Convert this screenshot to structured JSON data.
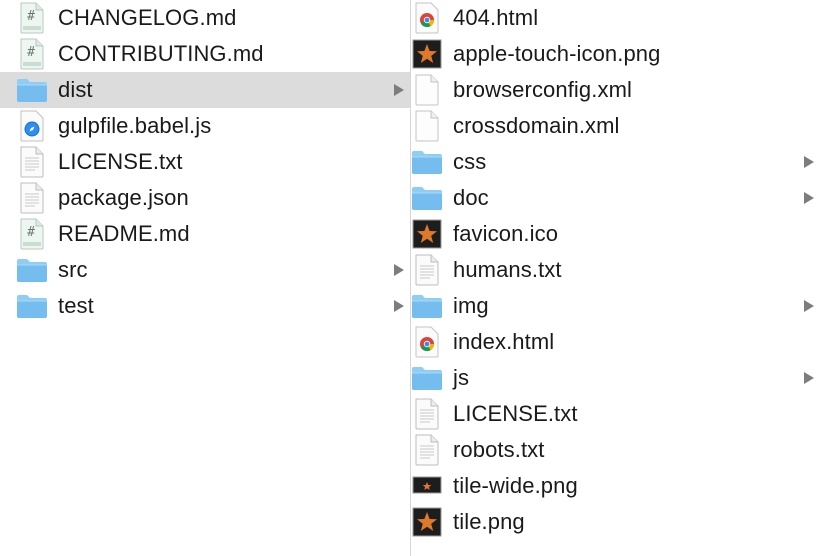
{
  "left_column": [
    {
      "name": "CHANGELOG.md",
      "icon": "markdown-file-icon",
      "folder": false
    },
    {
      "name": "CONTRIBUTING.md",
      "icon": "markdown-file-icon",
      "folder": false
    },
    {
      "name": "dist",
      "icon": "folder-icon",
      "folder": true,
      "selected": true
    },
    {
      "name": "gulpfile.babel.js",
      "icon": "safari-file-icon",
      "folder": false
    },
    {
      "name": "LICENSE.txt",
      "icon": "text-file-icon",
      "folder": false
    },
    {
      "name": "package.json",
      "icon": "text-file-icon",
      "folder": false
    },
    {
      "name": "README.md",
      "icon": "markdown-file-icon",
      "folder": false
    },
    {
      "name": "src",
      "icon": "folder-icon",
      "folder": true
    },
    {
      "name": "test",
      "icon": "folder-icon",
      "folder": true
    }
  ],
  "right_column": [
    {
      "name": "404.html",
      "icon": "chrome-file-icon",
      "folder": false
    },
    {
      "name": "apple-touch-icon.png",
      "icon": "star-image-icon",
      "folder": false
    },
    {
      "name": "browserconfig.xml",
      "icon": "blank-file-icon",
      "folder": false
    },
    {
      "name": "crossdomain.xml",
      "icon": "blank-file-icon",
      "folder": false
    },
    {
      "name": "css",
      "icon": "folder-icon",
      "folder": true
    },
    {
      "name": "doc",
      "icon": "folder-icon",
      "folder": true
    },
    {
      "name": "favicon.ico",
      "icon": "star-image-icon",
      "folder": false
    },
    {
      "name": "humans.txt",
      "icon": "text-file-icon",
      "folder": false
    },
    {
      "name": "img",
      "icon": "folder-icon",
      "folder": true
    },
    {
      "name": "index.html",
      "icon": "chrome-file-icon",
      "folder": false
    },
    {
      "name": "js",
      "icon": "folder-icon",
      "folder": true
    },
    {
      "name": "LICENSE.txt",
      "icon": "text-file-icon",
      "folder": false
    },
    {
      "name": "robots.txt",
      "icon": "text-file-icon",
      "folder": false
    },
    {
      "name": "tile-wide.png",
      "icon": "wide-image-icon",
      "folder": false
    },
    {
      "name": "tile.png",
      "icon": "star-image-icon",
      "folder": false
    }
  ],
  "colors": {
    "selection": "#dcdcdc",
    "folder": "#7cc4f2",
    "arrow": "#7d7d7d"
  }
}
